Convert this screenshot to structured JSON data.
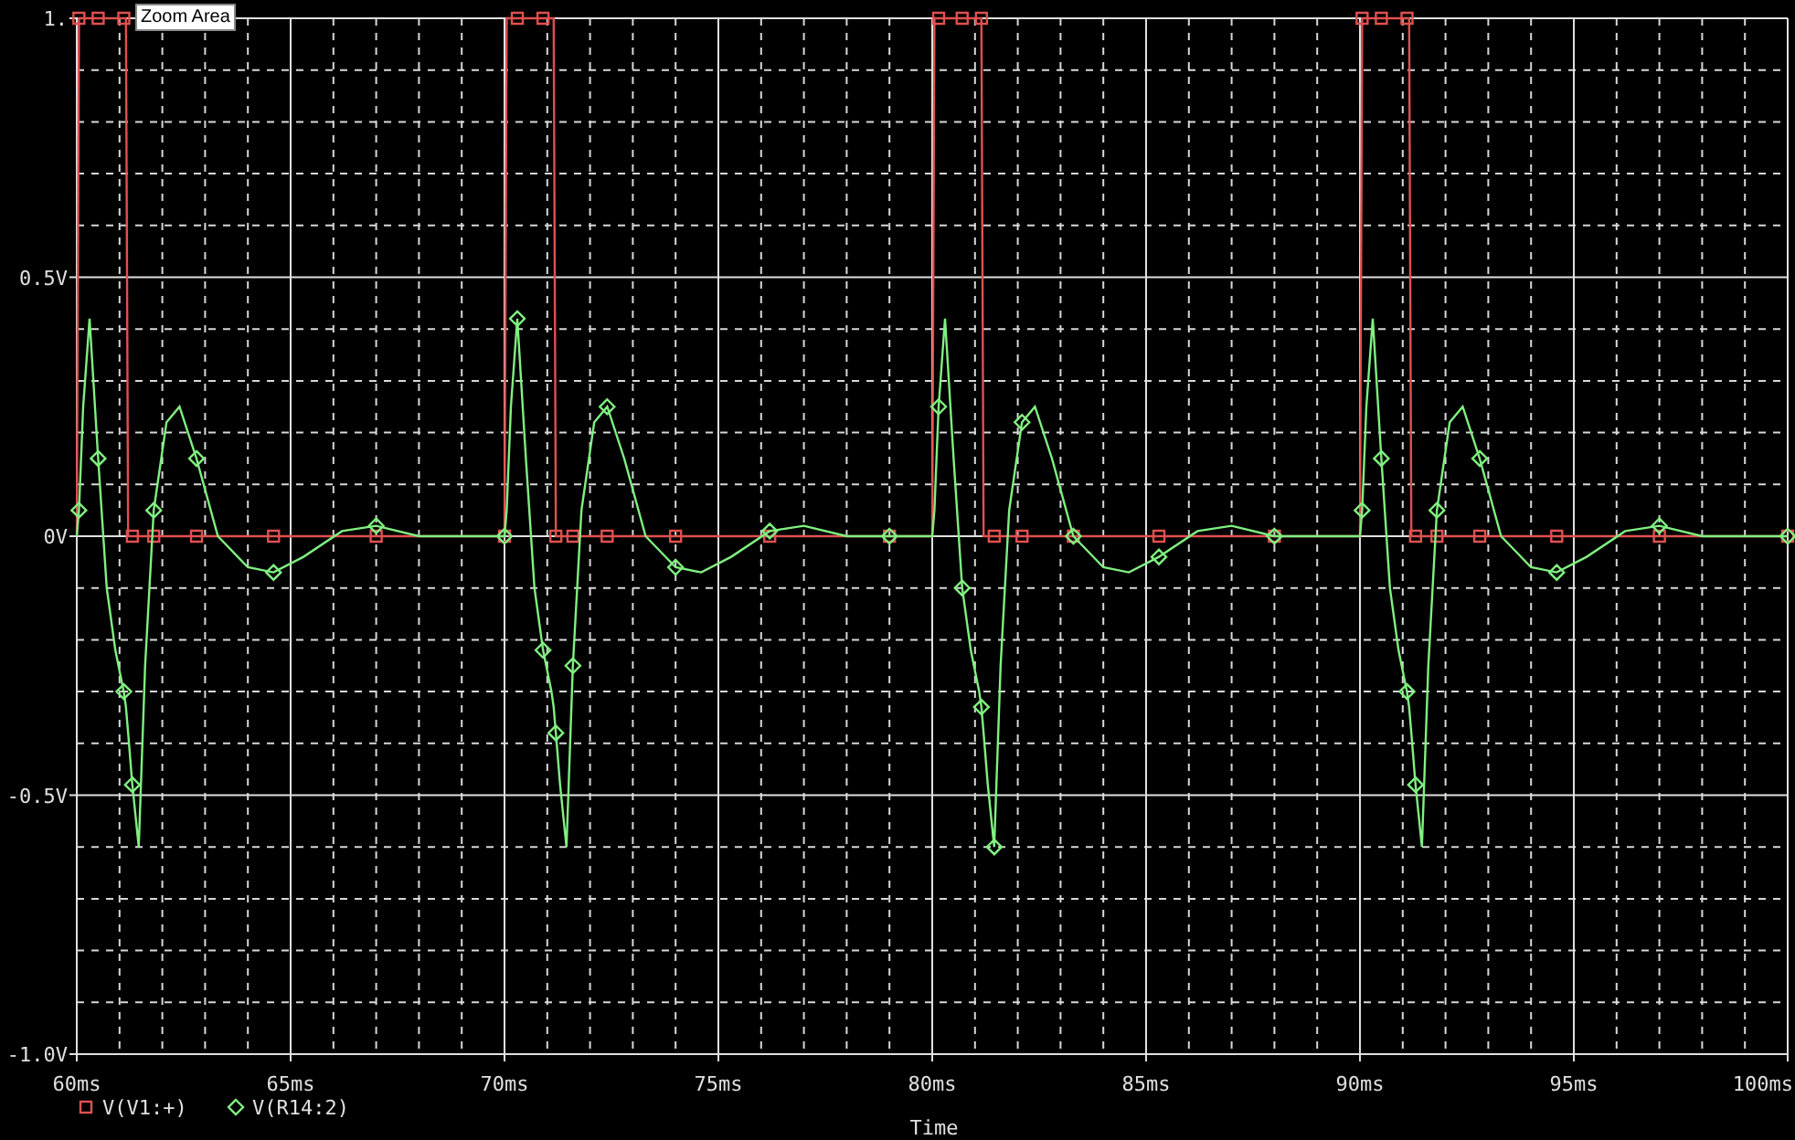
{
  "tooltip": {
    "text": "Zoom Area"
  },
  "plot": {
    "chart_data": {
      "type": "line",
      "xlabel": "Time",
      "grid": true,
      "legend": true,
      "x": [
        60,
        60.05,
        60.15,
        60.3,
        60.5,
        60.7,
        60.9,
        61.1,
        61.15,
        61.2,
        61.3,
        61.45,
        61.6,
        61.8,
        62.1,
        62.4,
        62.8,
        63.3,
        64,
        64.6,
        65.3,
        66.2,
        67,
        68,
        69,
        70,
        70.05,
        70.15,
        70.3,
        70.5,
        70.7,
        70.9,
        71.1,
        71.15,
        71.2,
        71.3,
        71.45,
        71.6,
        71.8,
        72.1,
        72.4,
        72.8,
        73.3,
        74,
        74.6,
        75.3,
        76.2,
        77,
        78,
        79,
        80,
        80.05,
        80.15,
        80.3,
        80.5,
        80.7,
        80.9,
        81.1,
        81.15,
        81.2,
        81.3,
        81.45,
        81.6,
        81.8,
        82.1,
        82.4,
        82.8,
        83.3,
        84,
        84.6,
        85.3,
        86.2,
        87,
        88,
        89,
        90,
        90.05,
        90.15,
        90.3,
        90.5,
        90.7,
        90.9,
        91.1,
        91.15,
        91.2,
        91.3,
        91.45,
        91.6,
        91.8,
        92.1,
        92.4,
        92.8,
        93.3,
        94,
        94.6,
        95.3,
        96.2,
        97,
        98,
        99,
        100
      ],
      "series": [
        {
          "name": "V(V1:+)",
          "color": "#e05050",
          "values": [
            0,
            1,
            1,
            1,
            1,
            1,
            1,
            1,
            1,
            0,
            0,
            0,
            0,
            0,
            0,
            0,
            0,
            0,
            0,
            0,
            0,
            0,
            0,
            0,
            0,
            0,
            1,
            1,
            1,
            1,
            1,
            1,
            1,
            1,
            0,
            0,
            0,
            0,
            0,
            0,
            0,
            0,
            0,
            0,
            0,
            0,
            0,
            0,
            0,
            0,
            0,
            1,
            1,
            1,
            1,
            1,
            1,
            1,
            1,
            0,
            0,
            0,
            0,
            0,
            0,
            0,
            0,
            0,
            0,
            0,
            0,
            0,
            0,
            0,
            0,
            0,
            1,
            1,
            1,
            1,
            1,
            1,
            1,
            1,
            0,
            0,
            0,
            0,
            0,
            0,
            0,
            0,
            0,
            0,
            0,
            0,
            0,
            0,
            0,
            0,
            0
          ]
        },
        {
          "name": "V(R14:2)",
          "color": "#80f080",
          "values": [
            0,
            0.05,
            0.25,
            0.42,
            0.15,
            -0.1,
            -0.22,
            -0.3,
            -0.33,
            -0.38,
            -0.48,
            -0.6,
            -0.25,
            0.05,
            0.22,
            0.25,
            0.15,
            0,
            -0.06,
            -0.07,
            -0.04,
            0.01,
            0.02,
            0,
            0,
            0,
            0.05,
            0.25,
            0.42,
            0.15,
            -0.1,
            -0.22,
            -0.3,
            -0.33,
            -0.38,
            -0.48,
            -0.6,
            -0.25,
            0.05,
            0.22,
            0.25,
            0.15,
            0,
            -0.06,
            -0.07,
            -0.04,
            0.01,
            0.02,
            0,
            0,
            0,
            0.05,
            0.25,
            0.42,
            0.15,
            -0.1,
            -0.22,
            -0.3,
            -0.33,
            -0.38,
            -0.48,
            -0.6,
            -0.25,
            0.05,
            0.22,
            0.25,
            0.15,
            0,
            -0.06,
            -0.07,
            -0.04,
            0.01,
            0.02,
            0,
            0,
            0,
            0.05,
            0.25,
            0.42,
            0.15,
            -0.1,
            -0.22,
            -0.3,
            -0.33,
            -0.38,
            -0.48,
            -0.6,
            -0.25,
            0.05,
            0.22,
            0.25,
            0.15,
            0,
            -0.06,
            -0.07,
            -0.04,
            0.01,
            0.02,
            0,
            0,
            0
          ]
        }
      ],
      "xlim": [
        60,
        100
      ],
      "ylim": [
        -1,
        1
      ],
      "xticks": [
        {
          "value": 60,
          "label": "60ms"
        },
        {
          "value": 65,
          "label": "65ms"
        },
        {
          "value": 70,
          "label": "70ms"
        },
        {
          "value": 75,
          "label": "75ms"
        },
        {
          "value": 80,
          "label": "80ms"
        },
        {
          "value": 85,
          "label": "85ms"
        },
        {
          "value": 90,
          "label": "90ms"
        },
        {
          "value": 95,
          "label": "95ms"
        },
        {
          "value": 100,
          "label": "100ms"
        }
      ],
      "yticks": [
        {
          "value": 1,
          "label": "1."
        },
        {
          "value": 0.5,
          "label": "0.5V"
        },
        {
          "value": 0,
          "label": "0V"
        },
        {
          "value": -0.5,
          "label": "-0.5V"
        },
        {
          "value": -1,
          "label": "-1.0V"
        }
      ]
    }
  }
}
